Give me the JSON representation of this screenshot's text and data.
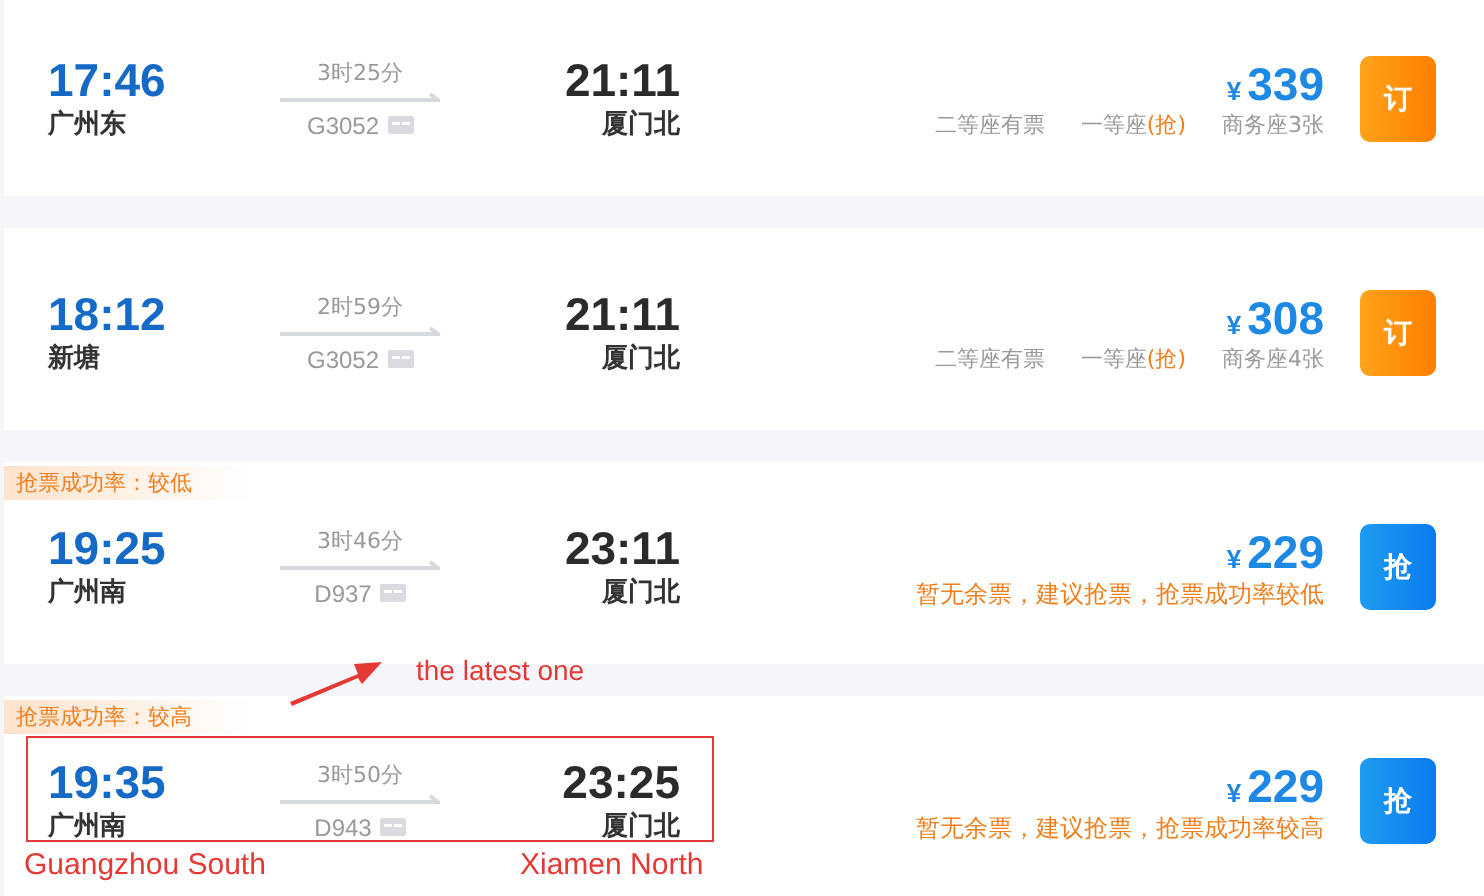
{
  "trains": [
    {
      "depart_time": "17:46",
      "depart_station": "广州东",
      "duration": "3时25分",
      "train_no": "G3052",
      "arrive_time": "21:11",
      "arrive_station": "厦门北",
      "currency": "¥",
      "price": "339",
      "availability": {
        "kind": "seats",
        "seats": [
          {
            "label": "二等座有票"
          },
          {
            "label": "一等座",
            "grab": "(抢)"
          },
          {
            "label": "商务座3张"
          }
        ]
      },
      "button": {
        "kind": "book",
        "label": "订"
      }
    },
    {
      "depart_time": "18:12",
      "depart_station": "新塘",
      "duration": "2时59分",
      "train_no": "G3052",
      "arrive_time": "21:11",
      "arrive_station": "厦门北",
      "currency": "¥",
      "price": "308",
      "availability": {
        "kind": "seats",
        "seats": [
          {
            "label": "二等座有票"
          },
          {
            "label": "一等座",
            "grab": "(抢)"
          },
          {
            "label": "商务座4张"
          }
        ]
      },
      "button": {
        "kind": "book",
        "label": "订"
      }
    },
    {
      "success_rate_tag": "抢票成功率：较低",
      "depart_time": "19:25",
      "depart_station": "广州南",
      "duration": "3时46分",
      "train_no": "D937",
      "arrive_time": "23:11",
      "arrive_station": "厦门北",
      "currency": "¥",
      "price": "229",
      "availability": {
        "kind": "note",
        "text": "暂无余票，建议抢票，抢票成功率较低"
      },
      "button": {
        "kind": "grab",
        "label": "抢"
      }
    },
    {
      "success_rate_tag": "抢票成功率：较高",
      "depart_time": "19:35",
      "depart_station": "广州南",
      "duration": "3时50分",
      "train_no": "D943",
      "arrive_time": "23:25",
      "arrive_station": "厦门北",
      "currency": "¥",
      "price": "229",
      "availability": {
        "kind": "note",
        "text": "暂无余票，建议抢票，抢票成功率较高"
      },
      "button": {
        "kind": "grab",
        "label": "抢"
      }
    }
  ],
  "annotations": {
    "callout": "the latest one",
    "labels": [
      "Guangzhou South",
      "Xiamen North"
    ]
  }
}
